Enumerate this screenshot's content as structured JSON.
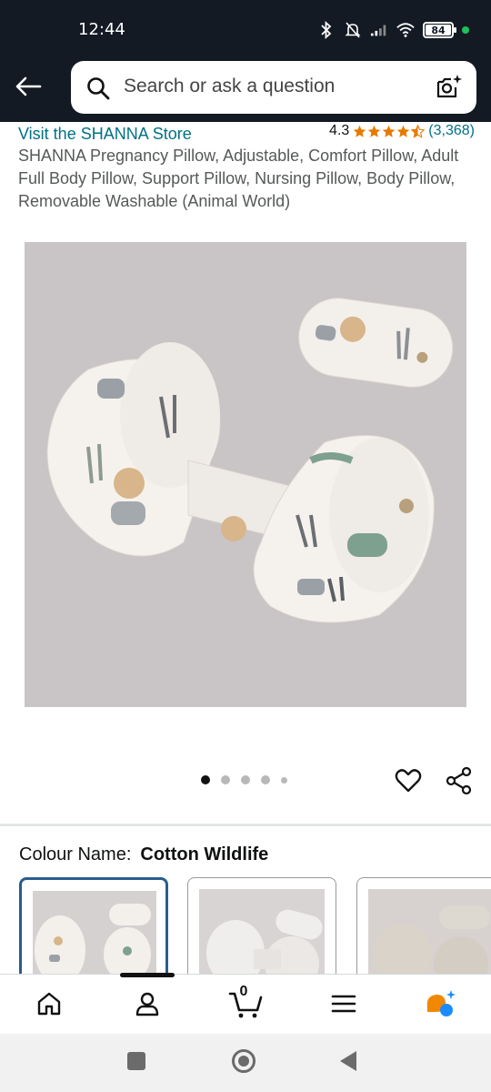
{
  "status_bar": {
    "time": "12:44",
    "battery": "84"
  },
  "search": {
    "placeholder": "Search or ask a question"
  },
  "product": {
    "store_link": "Visit the SHANNA Store",
    "rating": "4.3",
    "rating_stars": 4.3,
    "rating_count": "(3,368)",
    "title": "SHANNA Pregnancy Pillow, Adjustable, Comfort Pillow, Adult Full Body Pillow, Support Pillow, Nursing Pillow, Body Pillow, Removable Washable (Animal World)"
  },
  "carousel": {
    "count": 5,
    "active_index": 0
  },
  "colour": {
    "label": "Colour Name:",
    "value": "Cotton Wildlife"
  },
  "colors": {
    "link": "#007185",
    "star": "#e67a00",
    "topbar": "#141a24",
    "selected_border": "#2a5d8c"
  },
  "nav": {
    "cart_count": "0"
  },
  "icons": [
    "back-arrow-icon",
    "search-icon",
    "camera-icon",
    "heart-icon",
    "share-icon",
    "home-icon",
    "account-icon",
    "cart-icon",
    "menu-icon",
    "rufus-assistant-icon"
  ]
}
